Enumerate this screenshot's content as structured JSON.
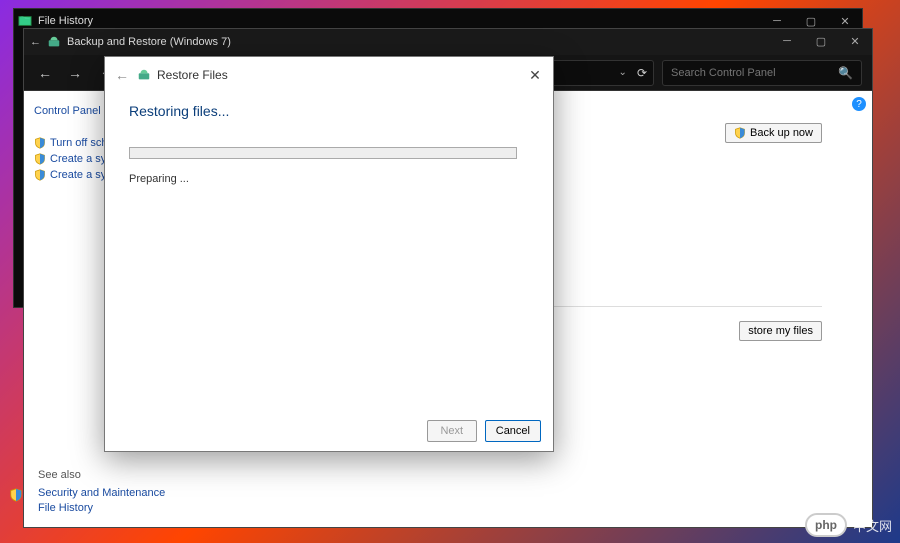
{
  "window1": {
    "title": "File History"
  },
  "window2": {
    "title": "Backup and Restore (Windows 7)",
    "search_placeholder": "Search Control Panel"
  },
  "sidebar": {
    "home": "Control Panel",
    "links": [
      "Turn off sche",
      "Create a syste",
      "Create a syste"
    ]
  },
  "main": {
    "backup_btn": "Back up now",
    "restore_btn": "store my files"
  },
  "see_also": {
    "header": "See also",
    "links": [
      "Security and Maintenance",
      "File History"
    ]
  },
  "dialog": {
    "title": "Restore Files",
    "heading": "Restoring files...",
    "status": "Preparing ...",
    "next": "Next",
    "cancel": "Cancel"
  },
  "watermark": {
    "logo": "php",
    "text": "中文网"
  }
}
